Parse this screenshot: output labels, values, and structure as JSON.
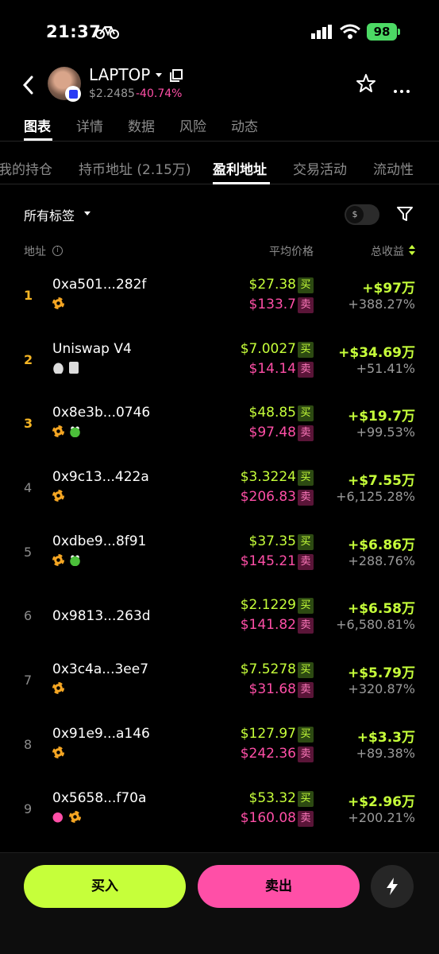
{
  "status_bar": {
    "time": "21:37",
    "battery": "98"
  },
  "header": {
    "token_name": "LAPTOP",
    "price": "$2.2485",
    "change": "-40.74%"
  },
  "main_tabs": [
    {
      "label": "图表",
      "active": true
    },
    {
      "label": "详情"
    },
    {
      "label": "数据"
    },
    {
      "label": "风险"
    },
    {
      "label": "动态"
    }
  ],
  "sub_tabs": [
    {
      "label": "我的持仓"
    },
    {
      "label": "持币地址 (2.15万)"
    },
    {
      "label": "盈利地址",
      "active": true
    },
    {
      "label": "交易活动"
    },
    {
      "label": "流动性"
    }
  ],
  "filter": {
    "all_tags": "所有标签",
    "currency_symbol": "$"
  },
  "columns": {
    "address": "地址",
    "avg_price": "平均价格",
    "total_pnl": "总收益"
  },
  "badges": {
    "buy": "买",
    "sell": "卖"
  },
  "rows": [
    {
      "rank": "1",
      "address": "0xa501...282f",
      "tags": [
        "sun-icon"
      ],
      "buy": "$27.38",
      "sell": "$133.7",
      "pnl": "+$97万",
      "pct": "+388.27%"
    },
    {
      "rank": "2",
      "address": "Uniswap V4",
      "tags": [
        "whale-icon",
        "receipt-icon"
      ],
      "buy": "$7.0027",
      "sell": "$14.14",
      "pnl": "+$34.69万",
      "pct": "+51.41%"
    },
    {
      "rank": "3",
      "address": "0x8e3b...0746",
      "tags": [
        "sun-icon",
        "frog-icon"
      ],
      "buy": "$48.85",
      "sell": "$97.48",
      "pnl": "+$19.7万",
      "pct": "+99.53%"
    },
    {
      "rank": "4",
      "address": "0x9c13...422a",
      "tags": [
        "sun-icon"
      ],
      "buy": "$3.3224",
      "sell": "$206.83",
      "pnl": "+$7.55万",
      "pct": "+6,125.28%"
    },
    {
      "rank": "5",
      "address": "0xdbe9...8f91",
      "tags": [
        "sun-icon",
        "frog-icon"
      ],
      "buy": "$37.35",
      "sell": "$145.21",
      "pnl": "+$6.86万",
      "pct": "+288.76%"
    },
    {
      "rank": "6",
      "address": "0x9813...263d",
      "tags": [],
      "buy": "$2.1229",
      "sell": "$141.82",
      "pnl": "+$6.58万",
      "pct": "+6,580.81%"
    },
    {
      "rank": "7",
      "address": "0x3c4a...3ee7",
      "tags": [
        "sun-icon"
      ],
      "buy": "$7.5278",
      "sell": "$31.68",
      "pnl": "+$5.79万",
      "pct": "+320.87%"
    },
    {
      "rank": "8",
      "address": "0x91e9...a146",
      "tags": [
        "sun-icon"
      ],
      "buy": "$127.97",
      "sell": "$242.36",
      "pnl": "+$3.3万",
      "pct": "+89.38%"
    },
    {
      "rank": "9",
      "address": "0x5658...f70a",
      "tags": [
        "fish-icon",
        "sun-icon"
      ],
      "buy": "$53.32",
      "sell": "$160.08",
      "pnl": "+$2.96万",
      "pct": "+200.21%"
    }
  ],
  "actions": {
    "buy": "买入",
    "sell": "卖出"
  },
  "colors": {
    "buy_green": "#c6ff3a",
    "sell_pink": "#ff4fa7",
    "rank_gold": "#f5b524"
  }
}
